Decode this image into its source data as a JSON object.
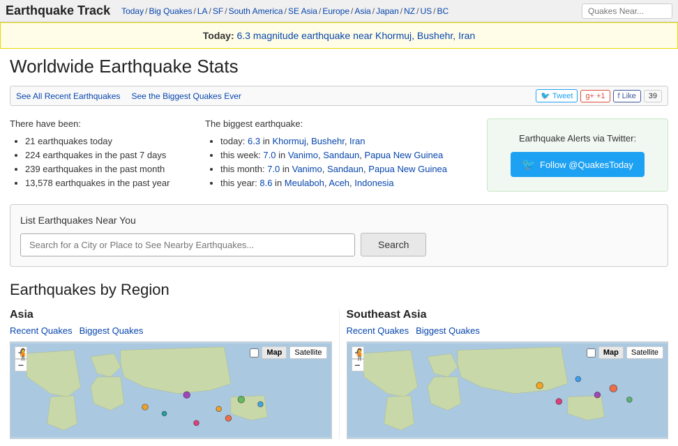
{
  "header": {
    "site_title": "Earthquake Track",
    "nav_links": [
      {
        "label": "Today",
        "sep": true
      },
      {
        "label": "Big Quakes",
        "sep": true
      },
      {
        "label": "LA",
        "sep": true
      },
      {
        "label": "SF",
        "sep": true
      },
      {
        "label": "South America",
        "sep": true
      },
      {
        "label": "SE Asia",
        "sep": true
      },
      {
        "label": "Europe",
        "sep": true
      },
      {
        "label": "Asia",
        "sep": true
      },
      {
        "label": "Japan",
        "sep": true
      },
      {
        "label": "NZ",
        "sep": true
      },
      {
        "label": "US",
        "sep": true
      },
      {
        "label": "BC",
        "sep": false
      }
    ],
    "search_placeholder": "Quakes Near..."
  },
  "alert": {
    "today_label": "Today:",
    "message": "6.3 magnitude earthquake near Khormuj, Bushehr, Iran"
  },
  "page_title": "Worldwide Earthquake Stats",
  "toolbar": {
    "btn1": "See All Recent Earthquakes",
    "btn2": "See the Biggest Quakes Ever",
    "tweet": "Tweet",
    "gplus": "+1",
    "like": "Like",
    "like_count": "39"
  },
  "stats": {
    "heading_left": "There have been:",
    "items": [
      "21 earthquakes today",
      "224 earthquakes in the past 7 days",
      "239 earthquakes in the past month",
      "13,578 earthquakes in the past year"
    ],
    "heading_middle": "The biggest earthquake:",
    "biggest": [
      {
        "prefix": "today:",
        "mag": "6.3",
        "suffix": " in ",
        "places": [
          "Khormuj",
          "Bushehr",
          "Iran"
        ]
      },
      {
        "prefix": "this week:",
        "mag": "7.0",
        "suffix": " in ",
        "places": [
          "Vanimo",
          "Sandaun",
          "Papua New Guinea"
        ]
      },
      {
        "prefix": "this month:",
        "mag": "7.0",
        "suffix": " in ",
        "places": [
          "Vanimo",
          "Sandaun",
          "Papua New Guinea"
        ]
      },
      {
        "prefix": "this year:",
        "mag": "8.6",
        "suffix": " in ",
        "places": [
          "Meulaboh",
          "Aceh",
          "Indonesia"
        ]
      }
    ],
    "alerts_title": "Earthquake Alerts via Twitter:",
    "follow_label": "Follow @QuakesToday"
  },
  "location_search": {
    "title": "List Earthquakes Near You",
    "placeholder": "Search for a City or Place to See Nearby Earthquakes...",
    "button_label": "Search"
  },
  "regions_heading": "Earthquakes by Region",
  "regions": [
    {
      "name": "Asia",
      "links": [
        "Recent Quakes",
        "Biggest Quakes"
      ],
      "markers": [
        {
          "x": 55,
          "y": 55,
          "color": "#9c27b0",
          "size": 10
        },
        {
          "x": 65,
          "y": 70,
          "color": "#ff9800",
          "size": 8
        },
        {
          "x": 72,
          "y": 60,
          "color": "#4caf50",
          "size": 10
        },
        {
          "x": 78,
          "y": 65,
          "color": "#2196f3",
          "size": 8
        },
        {
          "x": 68,
          "y": 80,
          "color": "#ff5722",
          "size": 9
        },
        {
          "x": 48,
          "y": 75,
          "color": "#009688",
          "size": 7
        },
        {
          "x": 58,
          "y": 85,
          "color": "#e91e63",
          "size": 8
        },
        {
          "x": 42,
          "y": 68,
          "color": "#ff9800",
          "size": 9
        }
      ]
    },
    {
      "name": "Southeast Asia",
      "links": [
        "Recent Quakes",
        "Biggest Quakes"
      ],
      "markers": [
        {
          "x": 60,
          "y": 45,
          "color": "#ff9800",
          "size": 10
        },
        {
          "x": 72,
          "y": 38,
          "color": "#2196f3",
          "size": 8
        },
        {
          "x": 78,
          "y": 55,
          "color": "#9c27b0",
          "size": 9
        },
        {
          "x": 83,
          "y": 48,
          "color": "#ff5722",
          "size": 11
        },
        {
          "x": 88,
          "y": 60,
          "color": "#4caf50",
          "size": 8
        },
        {
          "x": 66,
          "y": 62,
          "color": "#e91e63",
          "size": 9
        }
      ]
    }
  ]
}
